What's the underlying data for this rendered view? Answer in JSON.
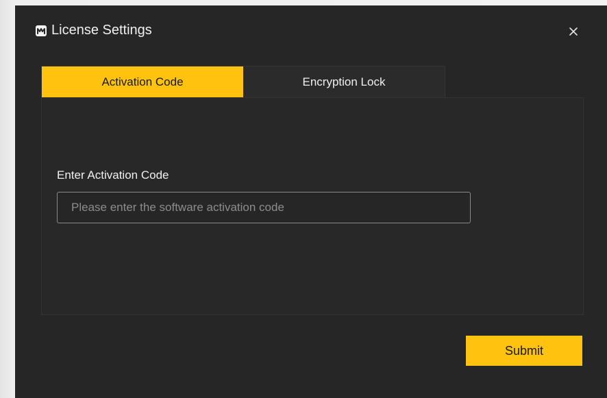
{
  "dialog": {
    "title": "License Settings",
    "logo_icon": "app-logo-icon",
    "close_icon": "close-icon"
  },
  "tabs": [
    {
      "label": "Activation Code",
      "active": true
    },
    {
      "label": "Encryption Lock",
      "active": false
    }
  ],
  "activation": {
    "field_label": "Enter Activation Code",
    "input_value": "",
    "input_placeholder": "Please enter the software activation code"
  },
  "actions": {
    "submit_label": "Submit"
  },
  "colors": {
    "accent": "#ffc20e",
    "dialog_background": "#262626",
    "text": "#f0f0f0",
    "placeholder": "#8c8c8c"
  }
}
